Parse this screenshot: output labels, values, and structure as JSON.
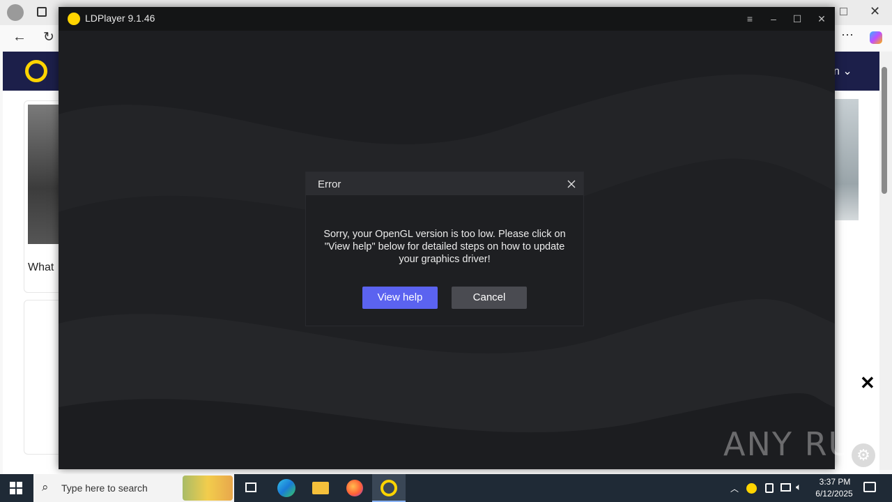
{
  "ld_window": {
    "title": "LDPlayer 9.1.46",
    "controls": [
      "menu-icon",
      "minimize-icon",
      "maximize-icon",
      "close-icon"
    ]
  },
  "dialog": {
    "title": "Error",
    "message": "Sorry, your OpenGL version is too low. Please click on \"View help\" below for detailed steps on how to update your graphics driver!",
    "primary_button": "View help",
    "secondary_button": "Cancel"
  },
  "background_page": {
    "partial_text": "What",
    "header_fragment": "n"
  },
  "watermark": "ANY RUN",
  "taskbar": {
    "search_placeholder": "Type here to search",
    "time": "3:37 PM",
    "date": "6/12/2025",
    "apps": [
      "task-view-icon",
      "edge-icon",
      "file-explorer-icon",
      "firefox-icon",
      "ldplayer-icon"
    ]
  },
  "colors": {
    "primary_button": "#5b63f0",
    "dialog_bg": "#1e1f22",
    "taskbar_bg": "#1f2a36",
    "site_header": "#1c1f4a"
  }
}
